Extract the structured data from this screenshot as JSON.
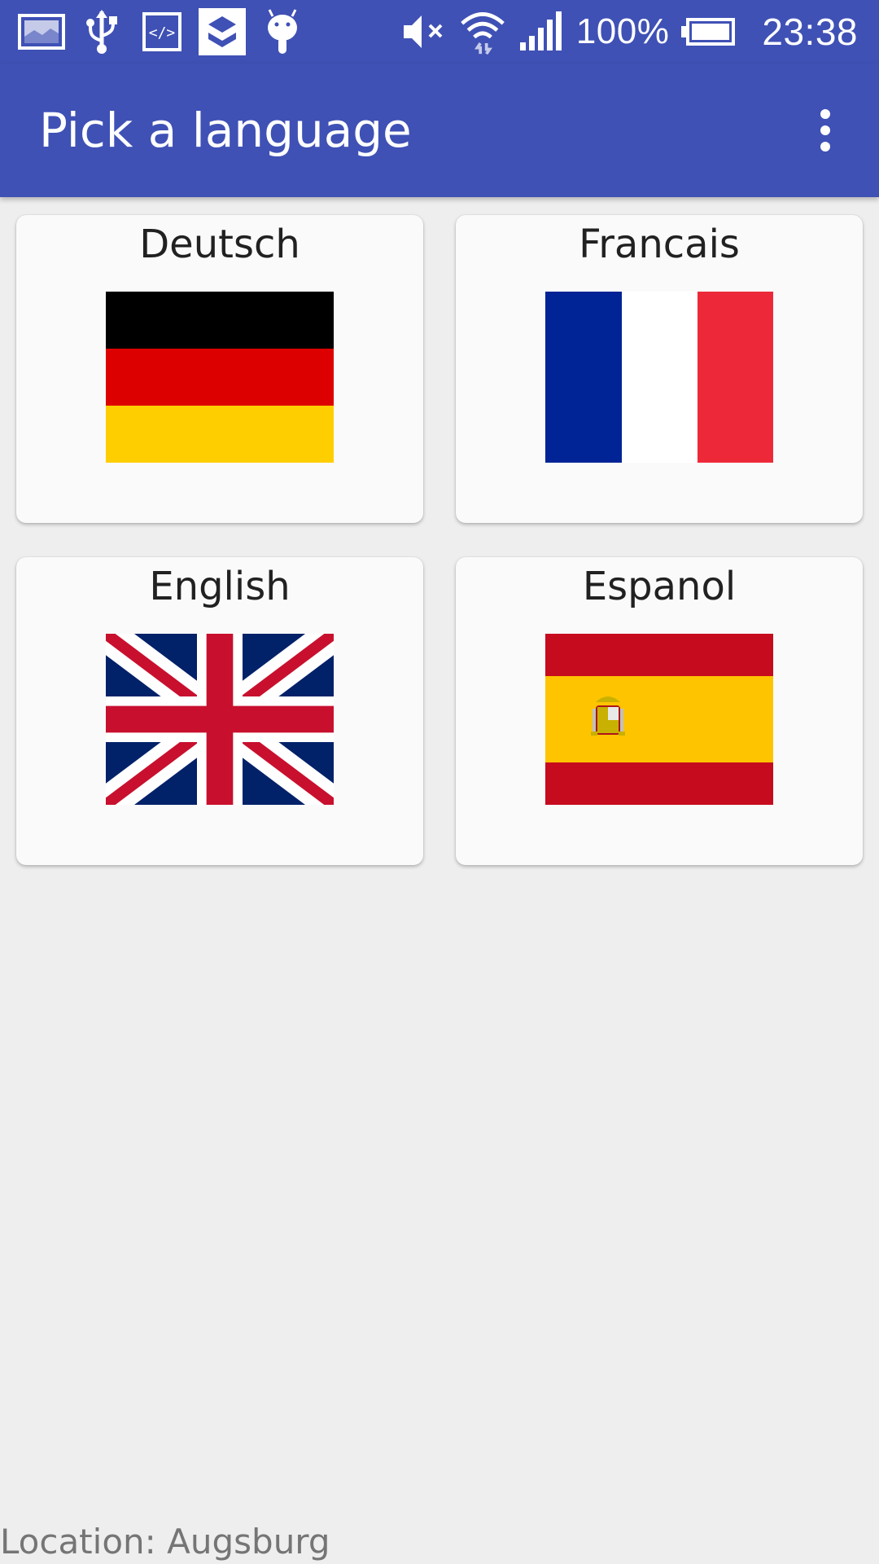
{
  "status_bar": {
    "left_icons": [
      "gallery-icon",
      "usb-icon",
      "code-icon",
      "app-store-icon",
      "android-icon"
    ],
    "right_icons": [
      "mute-icon",
      "wifi-icon",
      "signal-icon"
    ],
    "battery_percent": "100%",
    "time": "23:38"
  },
  "app_bar": {
    "title": "Pick a language",
    "overflow_icon": "more-vert-icon"
  },
  "languages": [
    {
      "label": "Deutsch",
      "flag": "germany-flag",
      "colors": [
        "#000000",
        "#dd0000",
        "#ffce00"
      ]
    },
    {
      "label": "Francais",
      "flag": "france-flag",
      "colors": [
        "#002395",
        "#ffffff",
        "#ed2939"
      ]
    },
    {
      "label": "English",
      "flag": "uk-flag",
      "colors": [
        "#012169",
        "#ffffff",
        "#c8102e"
      ]
    },
    {
      "label": "Espanol",
      "flag": "spain-flag",
      "colors": [
        "#c60b1e",
        "#ffc400"
      ]
    }
  ],
  "footer": {
    "location": "Location: Augsburg"
  },
  "colors": {
    "primary": "#3f51b5",
    "background": "#eeeeee",
    "card": "#fafafa"
  }
}
